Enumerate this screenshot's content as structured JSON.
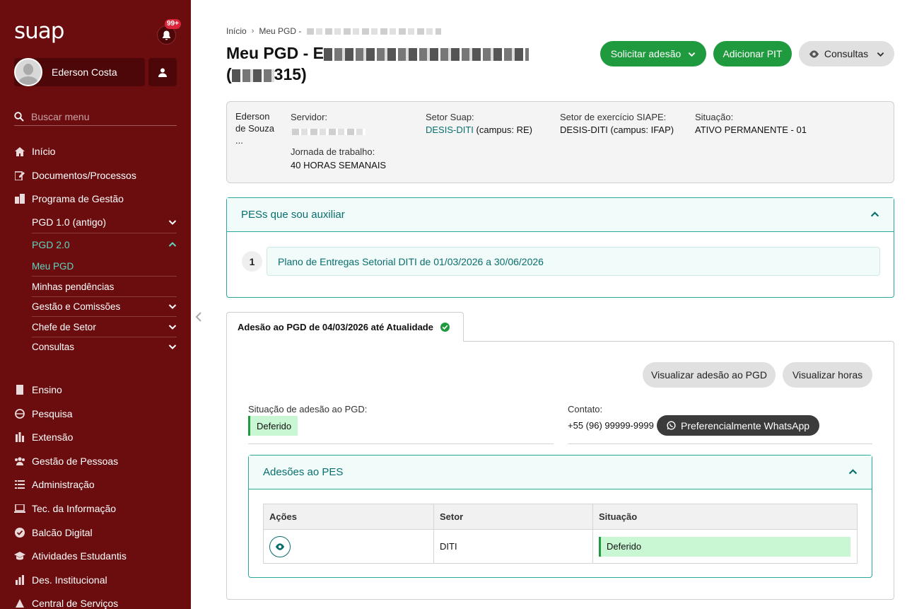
{
  "sidebar": {
    "logo": "suap",
    "notifications_badge": "99+",
    "user_name": "Ederson Costa",
    "search_placeholder": "Buscar menu",
    "menu": {
      "inicio": "Início",
      "documentos": "Documentos/Processos",
      "programa_gestao": "Programa de Gestão",
      "pgd1": "PGD 1.0 (antigo)",
      "pgd2": "PGD 2.0",
      "meu_pgd": "Meu PGD",
      "minhas_pendencias": "Minhas pendências",
      "gestao_comissoes": "Gestão e Comissões",
      "chefe_setor": "Chefe de Setor",
      "consultas": "Consultas",
      "ensino": "Ensino",
      "pesquisa": "Pesquisa",
      "extensao": "Extensão",
      "gestao_pessoas": "Gestão de Pessoas",
      "administracao": "Administração",
      "tec_informacao": "Tec. da Informação",
      "balcao_digital": "Balcão Digital",
      "atividades_estudantis": "Atividades Estudantis",
      "des_institucional": "Des. Institucional",
      "central_servicos": "Central de Serviços"
    },
    "accent_color": "#5fd6c0",
    "bg_color": "#6b0d0f"
  },
  "breadcrumb": {
    "home": "Início",
    "current": "Meu PGD -"
  },
  "page": {
    "title_prefix": "Meu PGD - E",
    "title_suffix": "315)",
    "title_paren": "("
  },
  "actions": {
    "solicitar_adesao": "Solicitar adesão",
    "adicionar_pit": "Adicionar PIT",
    "consultas": "Consultas"
  },
  "info": {
    "photo_alt": "Ederson de Souza ...",
    "servidor_label": "Servidor:",
    "jornada_label": "Jornada de trabalho:",
    "jornada_value": "40 HORAS SEMANAIS",
    "setor_suap_label": "Setor Suap:",
    "setor_suap_link": "DESIS-DITI",
    "setor_suap_campus": " (campus: RE)",
    "setor_siape_label": "Setor de exercício SIAPE:",
    "setor_siape_value": "DESIS-DITI (campus: IFAP)",
    "situacao_label": "Situação:",
    "situacao_value": "ATIVO PERMANENTE - 01"
  },
  "pes_panel": {
    "title": "PESs que sou auxiliar",
    "item_number": "1",
    "item_label": "Plano de Entregas Setorial DITI de 01/03/2026 a 30/06/2026"
  },
  "tab": {
    "label": "Adesão ao PGD de 04/03/2026 até Atualidade"
  },
  "tab_body": {
    "visualizar_adesao": "Visualizar adesão ao PGD",
    "visualizar_horas": "Visualizar horas",
    "situacao_label": "Situação de adesão ao PGD:",
    "situacao_value": "Deferido",
    "contato_label": "Contato:",
    "contato_value": "+55 (96) 99999-9999",
    "whatsapp_label": "Preferencialmente WhatsApp"
  },
  "adesoes_panel": {
    "title": "Adesões ao PES",
    "columns": [
      "Ações",
      "Setor",
      "Situação"
    ],
    "rows": [
      {
        "setor": "DITI",
        "situacao": "Deferido"
      }
    ]
  }
}
